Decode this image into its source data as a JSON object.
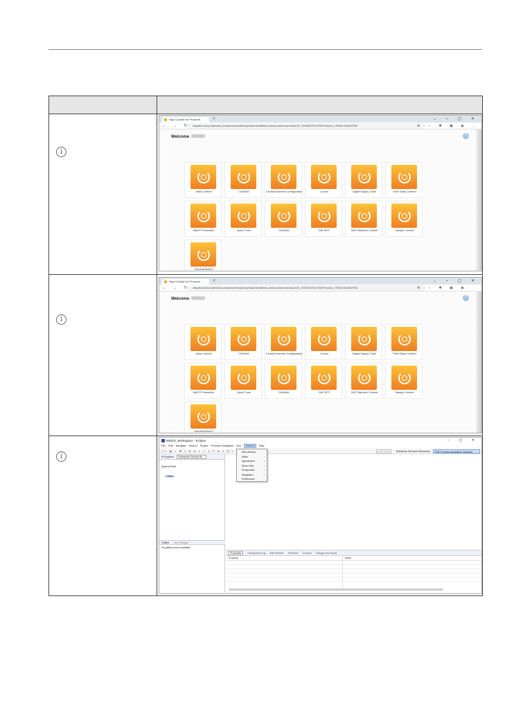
{
  "rows": [
    {
      "info_icon": "info-icon",
      "browser": {
        "tab_title": "Sign Cockpit for Producer",
        "new_tab": "+",
        "window_controls": "⌄ – ▢ ✕",
        "nav_buttons": "← → ↻",
        "url": "sdsuation.hana.ondemand.com/sdcontent/sdcfoody/index.html#library-Library-mdfa/rows=bossIL0D_TGD8GSTRU/YEDKProductL_kTFIM4CDAAS/SF6A",
        "toolbar_icons": "⊕ ☆ ✱ ▣ ◉ ⋮",
        "welcome": "Welcome",
        "help": "?"
      },
      "tiles": [
        "Ariba Content",
        "C4HANA",
        "Central Business Configuration",
        "Concur",
        "Digital Supply Chain",
        "Field Glass Content",
        "MMCP Production",
        "Quick Tours",
        "S4HANA",
        "SAP BTP",
        "SAP Standard Content",
        "Sample Content",
        "SuccessFactors"
      ]
    },
    {
      "info_icon": "info-icon",
      "browser": {
        "tab_title": "Sign Cockpit for Producer",
        "new_tab": "+",
        "window_controls": "⌄ – ▢ ✕",
        "nav_buttons": "← → ↻",
        "url": "sdsuation.hana.ondemand.com/sdcontent/sdcfoody/index.html#library-Library-mdfa/rows=bossIL0D_TGD8GSTRU/YEDKProductL_kTFIM4CDAAS/SF6A",
        "toolbar_icons": "⊕ ☆ ✱ ▣ ◉ ⋮",
        "welcome": "Welcome",
        "help": "?"
      },
      "tiles": [
        "Ariba Content",
        "C4HANA",
        "Central Business Configuration",
        "Concur",
        "Digital Supply Chain",
        "Field Glass Content",
        "MMCP Production",
        "Quick Tours",
        "S4HANA",
        "SAP BTP",
        "SAP Standard Content",
        "Sample Content",
        "SuccessFactors"
      ]
    }
  ],
  "eclipse": {
    "info_icon": "info-icon",
    "title": "NWDS_Workspace - Eclipse",
    "window_controls": "– ▢ ✕",
    "menu": [
      "File",
      "Edit",
      "Navigate",
      "Search",
      "Project",
      "Process Integration",
      "Run",
      "Window",
      "Help"
    ],
    "active_menu": "Window",
    "toolbar_icons": "▢▾ ▣ ⌕ ✱ ▾ ◈ ⇄ ▸ ◇ ▾ ⟳ ⇆ ▾ ⊞ ◐ ▾ ⊙ ▾ ⇦ ⇨ ▾",
    "quick_access": "Quick Access",
    "perspective_1": "Enterprise Services Repository",
    "perspective_2": "SAP Process Integration Designer",
    "left_tabs": [
      "PI Explorer",
      "Enterprise Service Br..."
    ],
    "tree_title": "System/SWA",
    "tree_item": "Offline",
    "outline_tabs": [
      "Outline",
      "My Changes"
    ],
    "outline_message": "No platforms not available",
    "props_tabs": [
      "Properties",
      "Deployment Log",
      "Alert Reader",
      "Problems",
      "Console",
      "Change and Inputs"
    ],
    "props_columns": [
      "Property",
      "Value"
    ],
    "dropdown": [
      {
        "label": "New Window",
        "submenu": false
      },
      {
        "label": "Editor",
        "submenu": true
      },
      {
        "label": "Appearance",
        "submenu": true
      },
      {
        "label": "Show View",
        "submenu": true
      },
      {
        "label": "Perspective",
        "submenu": true
      },
      {
        "label": "Navigation",
        "submenu": true
      },
      {
        "label": "Preferences",
        "submenu": false
      }
    ]
  }
}
